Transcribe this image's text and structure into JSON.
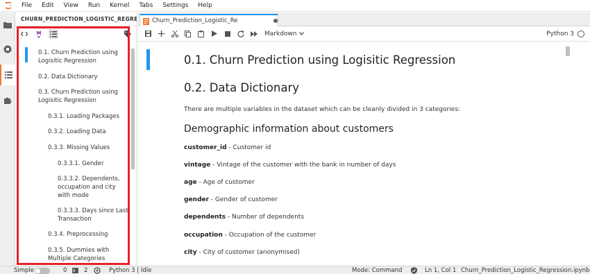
{
  "menu": {
    "items": [
      "File",
      "Edit",
      "View",
      "Run",
      "Kernel",
      "Tabs",
      "Settings",
      "Help"
    ]
  },
  "activity_bar": {
    "icons": [
      "folder-icon",
      "stop-circle-icon",
      "list-icon",
      "puzzle-icon"
    ],
    "accent": "#f37626"
  },
  "left_panel": {
    "header": "CHURN_PREDICTION_LOGISTIC_REGRESSI",
    "toolbar_icons": [
      "code-icon",
      "markdown-icon",
      "numbered-list-icon",
      "tag-icon"
    ],
    "toc": [
      {
        "label": "0.1. Churn Prediction using",
        "label2": "Logisitic Regression",
        "level": 1,
        "active": true
      },
      {
        "label": "0.2. Data Dictionary",
        "label2": "",
        "level": 1,
        "active": false
      },
      {
        "label": "0.3. Churn Prediction using",
        "label2": "Logisitic Regression",
        "level": 1,
        "active": false
      },
      {
        "label": "0.3.1. Loading Packages",
        "label2": "",
        "level": 2,
        "active": false
      },
      {
        "label": "0.3.2. Loading Data",
        "label2": "",
        "level": 2,
        "active": false
      },
      {
        "label": "0.3.3. Missing Values",
        "label2": "",
        "level": 2,
        "active": false
      },
      {
        "label": "0.3.3.1. Gender",
        "label2": "",
        "level": 3,
        "active": false
      },
      {
        "label": "0.3.3.2. Dependents,",
        "label2": "occupation and city",
        "label3": "with mode",
        "level": 3,
        "active": false
      },
      {
        "label": "0.3.3.3. Days since Last",
        "label2": "Transaction",
        "level": 3,
        "active": false
      },
      {
        "label": "0.3.4. Preprocessing",
        "label2": "",
        "level": 2,
        "active": false
      },
      {
        "label": "0.3.5. Dummies with",
        "label2": "Multiple Categories",
        "level": 2,
        "active": false
      }
    ],
    "highlight_color": "#e8202a"
  },
  "tab": {
    "label": "Churn_Prediction_Logistic_Re",
    "icon": "notebook-icon",
    "accent": "#2196f3"
  },
  "notebook_toolbar": {
    "tools": [
      "save-icon",
      "add-cell-icon",
      "cut-icon",
      "copy-icon",
      "paste-icon",
      "run-icon",
      "stop-icon",
      "restart-icon",
      "fast-forward-icon"
    ],
    "cell_type": "Markdown",
    "kernel": "Python 3"
  },
  "notebook": {
    "h1_title": "0.1. Churn Prediction using Logisitic Regression",
    "h2_title": "0.2. Data Dictionary",
    "intro": "There are multiple variables in the dataset which can be cleanly divided in 3 categories:",
    "h3_title": "Demographic information about customers",
    "fields": [
      {
        "name": "customer_id",
        "desc": " - Customer id"
      },
      {
        "name": "vintage",
        "desc": " - Vintage of the customer with the bank in number of days"
      },
      {
        "name": "age",
        "desc": " - Age of customer"
      },
      {
        "name": "gender",
        "desc": " - Gender of customer"
      },
      {
        "name": "dependents",
        "desc": " - Number of dependents"
      },
      {
        "name": "occupation",
        "desc": " - Occupation of the customer"
      },
      {
        "name": "city",
        "desc": " - City of customer (anonymised)"
      }
    ]
  },
  "status_bar": {
    "mode_simple": "Simple",
    "terminals": "0",
    "kernels": "2",
    "kernel_status": "Python 3 | Idle",
    "mode": "Mode: Command",
    "position": "Ln 1, Col 1",
    "filename": "Churn_Prediction_Logistic_Regression.ipynb"
  }
}
